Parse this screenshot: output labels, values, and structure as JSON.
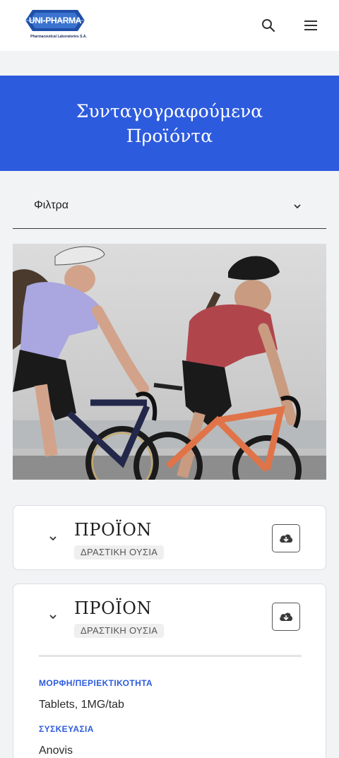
{
  "header": {
    "logo_text": "UNI-PHARMA",
    "logo_subtitle": "Pharmaceutical Laboratories S.A.",
    "search_icon": "search-icon",
    "menu_icon": "hamburger-menu-icon"
  },
  "hero": {
    "title": "Συνταγογραφούμενα Προϊόντα",
    "background_color": "#2d5bdd"
  },
  "filters": {
    "label": "Φιλτρα"
  },
  "photo": {
    "icon": "cyclists-photo"
  },
  "products": [
    {
      "title": "ΠΡΟΪΟΝ",
      "badge": "ΔΡΑΣΤΙΚΗ ΟΥΣΙΑ",
      "expanded": false
    },
    {
      "title": "ΠΡΟΪΟΝ",
      "badge": "ΔΡΑΣΤΙΚΗ ΟΥΣΙΑ",
      "expanded": true,
      "details": [
        {
          "label": "ΜΟΡΦΗ/ΠΕΡΙΕΚΤΙΚΟΤΗΤΑ",
          "value": "Tablets, 1MG/tab"
        },
        {
          "label": "ΣΥΣΚΕΥΑΣΙΑ",
          "value": "Anovis"
        }
      ]
    }
  ],
  "colors": {
    "accent": "#2d5bdd",
    "page_background": "#f2f3f5"
  }
}
